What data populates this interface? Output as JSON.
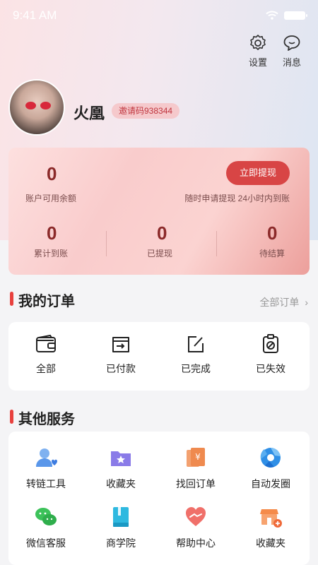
{
  "status_bar": {
    "time": "9:41 AM"
  },
  "header": {
    "settings_label": "设置",
    "messages_label": "消息"
  },
  "profile": {
    "name": "火凰",
    "invite_code": "邀请码938344"
  },
  "wallet": {
    "balance": "0",
    "balance_label": "账户可用余额",
    "withdraw_button": "立即提现",
    "withdraw_note": "随时申请提现 24小时内到账",
    "stats": [
      {
        "value": "0",
        "label": "累计到账"
      },
      {
        "value": "0",
        "label": "已提现"
      },
      {
        "value": "0",
        "label": "待结算"
      }
    ]
  },
  "orders": {
    "title": "我的订单",
    "all_link": "全部订单",
    "items": [
      {
        "label": "全部",
        "icon": "wallet-icon"
      },
      {
        "label": "已付款",
        "icon": "paid-card-icon"
      },
      {
        "label": "已完成",
        "icon": "edit-square-icon"
      },
      {
        "label": "已失效",
        "icon": "clipboard-ban-icon"
      }
    ]
  },
  "services": {
    "title": "其他服务",
    "items": [
      {
        "label": "转链工具",
        "icon": "user-heart-icon"
      },
      {
        "label": "收藏夹",
        "icon": "star-folder-icon"
      },
      {
        "label": "找回订单",
        "icon": "receipt-yen-icon"
      },
      {
        "label": "自动发圈",
        "icon": "aperture-icon"
      },
      {
        "label": "微信客服",
        "icon": "wechat-icon"
      },
      {
        "label": "商学院",
        "icon": "book-icon"
      },
      {
        "label": "帮助中心",
        "icon": "handshake-heart-icon"
      },
      {
        "label": "收藏夹",
        "icon": "store-add-icon"
      }
    ]
  },
  "colors": {
    "accent": "#e8413e",
    "button": "#d84545",
    "wallet_text": "#8b2a2a"
  }
}
